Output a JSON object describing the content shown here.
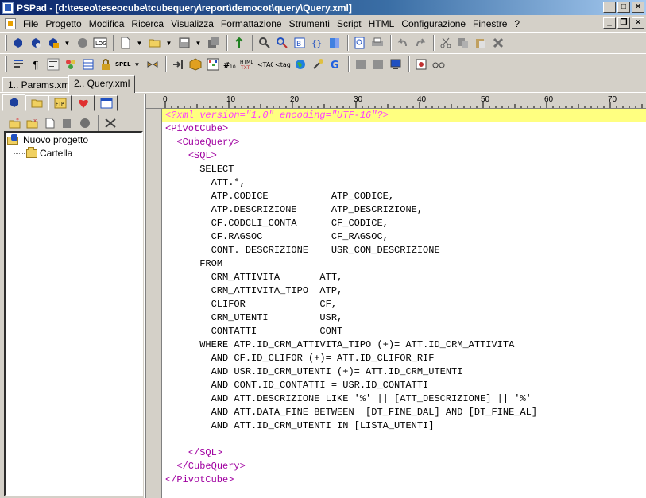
{
  "window": {
    "app_name": "PSPad",
    "title": "PSPad - [d:\\teseo\\teseocube\\tcubequery\\report\\democot\\query\\Query.xml]",
    "controls": {
      "minimize": "_",
      "maximize": "□",
      "close": "×",
      "restore": "❐"
    }
  },
  "menu": {
    "items": [
      "File",
      "Progetto",
      "Modifica",
      "Ricerca",
      "Visualizza",
      "Formattazione",
      "Strumenti",
      "Script",
      "HTML",
      "Configurazione",
      "Finestre",
      "?"
    ]
  },
  "toolbar1": {
    "buttons": [
      "project-icon",
      "open-project-icon",
      "save-project-icon",
      "dropdown-icon",
      "log-icon",
      "new-file-icon",
      "dropdown-icon",
      "open-file-icon",
      "dropdown-icon",
      "save-file-icon",
      "dropdown-icon",
      "save-all-icon",
      "spellcheck-icon",
      "find-icon",
      "replace-icon",
      "bookmark-icon",
      "brackets-icon",
      "book-icon",
      "preview-icon",
      "print-icon",
      "undo-icon",
      "redo-icon",
      "cut-icon",
      "copy-icon",
      "paste-icon",
      "delete-icon"
    ]
  },
  "toolbar2": {
    "buttons": [
      "format-icon",
      "pilcrow-icon",
      "wrap-icon",
      "color-icon",
      "table-icon",
      "lock-icon",
      "spell-icon",
      "dropdown-icon",
      "link-icon",
      "indent-icon",
      "package-icon",
      "chart-icon",
      "hash-icon",
      "html-text-icon",
      "tag-icon",
      "tag-small-icon",
      "globe-icon",
      "tools-icon",
      "google-icon",
      "block1-icon",
      "block2-icon",
      "monitor-icon",
      "record-icon",
      "glasses-icon"
    ]
  },
  "tabs": [
    {
      "label": "1.. Params.xml",
      "active": false
    },
    {
      "label": "2.. Query.xml",
      "active": true
    }
  ],
  "left_panel": {
    "tabs": [
      "project-tab-icon",
      "folder-tab-icon",
      "ftp-tab-icon",
      "favorites-tab-icon",
      "windows-tab-icon"
    ],
    "ftp_label": "FTP",
    "tree": {
      "root": "Nuovo progetto",
      "children": [
        "Cartella"
      ]
    }
  },
  "ruler": {
    "marks": [
      "0",
      "10",
      "20",
      "30",
      "40",
      "50",
      "60",
      "70"
    ]
  },
  "editor": {
    "lines": [
      {
        "indent": "",
        "text": "<?xml version=\"1.0\" encoding=\"UTF-16\"?>",
        "kind": "decl"
      },
      {
        "indent": "",
        "text": "<PivotCube>",
        "kind": "tag"
      },
      {
        "indent": "  ",
        "text": "<CubeQuery>",
        "kind": "tag"
      },
      {
        "indent": "    ",
        "text": "<SQL>",
        "kind": "tag"
      },
      {
        "indent": "      ",
        "text": "SELECT",
        "kind": "sql"
      },
      {
        "indent": "        ",
        "text": "ATT.*,",
        "kind": "sql"
      },
      {
        "indent": "        ",
        "text": "ATP.CODICE           ATP_CODICE,",
        "kind": "sql"
      },
      {
        "indent": "        ",
        "text": "ATP.DESCRIZIONE      ATP_DESCRIZIONE,",
        "kind": "sql"
      },
      {
        "indent": "        ",
        "text": "CF.CODCLI_CONTA      CF_CODICE,",
        "kind": "sql"
      },
      {
        "indent": "        ",
        "text": "CF.RAGSOC            CF_RAGSOC,",
        "kind": "sql"
      },
      {
        "indent": "        ",
        "text": "CONT. DESCRIZIONE    USR_CON_DESCRIZIONE",
        "kind": "sql"
      },
      {
        "indent": "      ",
        "text": "FROM",
        "kind": "sql"
      },
      {
        "indent": "        ",
        "text": "CRM_ATTIVITA       ATT,",
        "kind": "sql"
      },
      {
        "indent": "        ",
        "text": "CRM_ATTIVITA_TIPO  ATP,",
        "kind": "sql"
      },
      {
        "indent": "        ",
        "text": "CLIFOR             CF,",
        "kind": "sql"
      },
      {
        "indent": "        ",
        "text": "CRM_UTENTI         USR,",
        "kind": "sql"
      },
      {
        "indent": "        ",
        "text": "CONTATTI           CONT",
        "kind": "sql"
      },
      {
        "indent": "      ",
        "text": "WHERE ATP.ID_CRM_ATTIVITA_TIPO (+)= ATT.ID_CRM_ATTIVITA",
        "kind": "sql"
      },
      {
        "indent": "        ",
        "text": "AND CF.ID_CLIFOR (+)= ATT.ID_CLIFOR_RIF",
        "kind": "sql"
      },
      {
        "indent": "        ",
        "text": "AND USR.ID_CRM_UTENTI (+)= ATT.ID_CRM_UTENTI",
        "kind": "sql"
      },
      {
        "indent": "        ",
        "text": "AND CONT.ID_CONTATTI = USR.ID_CONTATTI",
        "kind": "sql"
      },
      {
        "indent": "        ",
        "text": "AND ATT.DESCRIZIONE LIKE '%' || [ATT_DESCRIZIONE] || '%'",
        "kind": "sql"
      },
      {
        "indent": "        ",
        "text": "AND ATT.DATA_FINE BETWEEN  [DT_FINE_DAL] AND [DT_FINE_AL]",
        "kind": "sql"
      },
      {
        "indent": "        ",
        "text": "AND ATT.ID_CRM_UTENTI IN [LISTA_UTENTI]",
        "kind": "sql"
      },
      {
        "indent": "",
        "text": "",
        "kind": "sql"
      },
      {
        "indent": "    ",
        "text": "</SQL>",
        "kind": "tag"
      },
      {
        "indent": "  ",
        "text": "</CubeQuery>",
        "kind": "tag"
      },
      {
        "indent": "",
        "text": "</PivotCube>",
        "kind": "tag"
      }
    ]
  },
  "colors": {
    "current_line": "#ffff80",
    "tag": "#a000a0",
    "declaration": "#ff40ff",
    "titlebar": "#0a246a"
  }
}
